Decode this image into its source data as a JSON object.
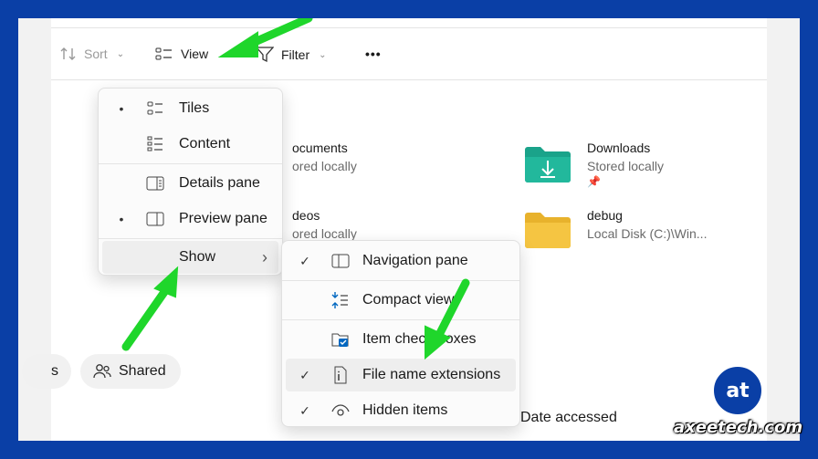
{
  "toolbar": {
    "sort_label": "Sort",
    "view_label": "View",
    "filter_label": "Filter",
    "more_label": "•••"
  },
  "files": [
    {
      "name": "ocuments",
      "sub": "ored locally"
    },
    {
      "name": "deos",
      "sub": "ored locally"
    },
    {
      "name": "Downloads",
      "sub": "Stored locally"
    },
    {
      "name": "debug",
      "sub": "Local Disk (C:)\\Win..."
    }
  ],
  "view_menu": {
    "items": [
      {
        "label": "Tiles",
        "mark": "•",
        "icon": "tiles-icon"
      },
      {
        "label": "Content",
        "mark": "",
        "icon": "content-icon"
      },
      {
        "label": "Details pane",
        "mark": "",
        "icon": "details-pane-icon"
      },
      {
        "label": "Preview pane",
        "mark": "•",
        "icon": "preview-pane-icon"
      },
      {
        "label": "Show",
        "mark": "",
        "icon": "",
        "submenu": "›"
      }
    ]
  },
  "show_menu": {
    "items": [
      {
        "label": "Navigation pane",
        "mark": "✓",
        "icon": "navigation-pane-icon"
      },
      {
        "label": "Compact view",
        "mark": "",
        "icon": "compact-view-icon"
      },
      {
        "label": "Item check boxes",
        "mark": "",
        "icon": "checkbox-icon"
      },
      {
        "label": "File name extensions",
        "mark": "✓",
        "icon": "file-extension-icon"
      },
      {
        "label": "Hidden items",
        "mark": "✓",
        "icon": "eye-icon"
      }
    ]
  },
  "chips": {
    "left_partial": "s",
    "shared_label": "Shared"
  },
  "column_header": "Date accessed",
  "brand": {
    "logo_text": "at",
    "site": "axeetech.com"
  },
  "colors": {
    "border_blue": "#0a3fa6",
    "arrow_green": "#1fd62b",
    "folder_teal": "#1aa38a",
    "folder_yellow": "#f5c542",
    "checkbox_blue": "#0067c0"
  }
}
